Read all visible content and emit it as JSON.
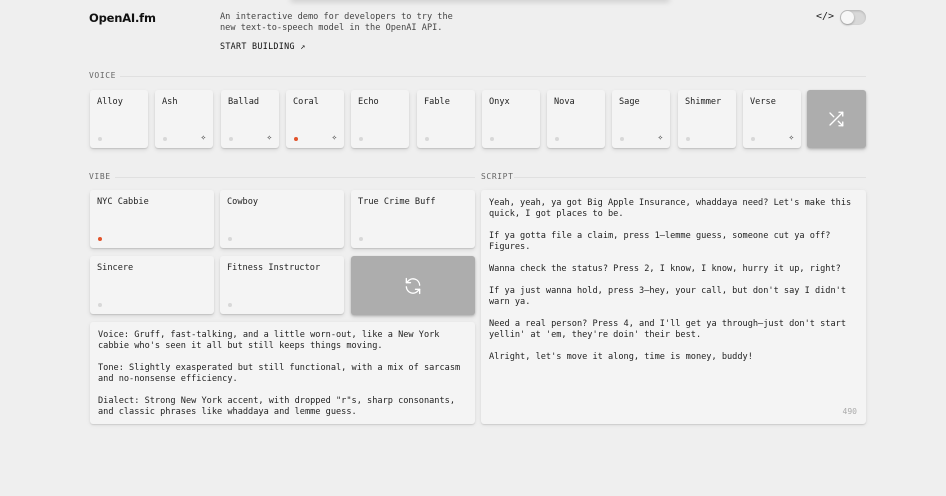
{
  "header": {
    "logo": "OpenAI.fm",
    "intro": "An interactive demo for developers to try the new text-to-speech model in the OpenAI API.",
    "start_building": "START BUILDING ↗",
    "code_icon": "</>",
    "dev_mode_toggle_on": false
  },
  "voice": {
    "section_label": "VOICE",
    "items": [
      {
        "label": "Alloy",
        "selected": false,
        "new": false
      },
      {
        "label": "Ash",
        "selected": false,
        "new": true
      },
      {
        "label": "Ballad",
        "selected": false,
        "new": true
      },
      {
        "label": "Coral",
        "selected": true,
        "new": true
      },
      {
        "label": "Echo",
        "selected": false,
        "new": false
      },
      {
        "label": "Fable",
        "selected": false,
        "new": false
      },
      {
        "label": "Onyx",
        "selected": false,
        "new": false
      },
      {
        "label": "Nova",
        "selected": false,
        "new": false
      },
      {
        "label": "Sage",
        "selected": false,
        "new": true
      },
      {
        "label": "Shimmer",
        "selected": false,
        "new": false
      },
      {
        "label": "Verse",
        "selected": false,
        "new": true
      }
    ],
    "shuffle_icon": "shuffle-icon",
    "new_icon": "sparkle-icon"
  },
  "vibe": {
    "section_label": "VIBE",
    "items": [
      {
        "label": "NYC Cabbie",
        "selected": true
      },
      {
        "label": "Cowboy",
        "selected": false
      },
      {
        "label": "True Crime Buff",
        "selected": false
      },
      {
        "label": "Sincere",
        "selected": false
      },
      {
        "label": "Fitness Instructor",
        "selected": false
      }
    ],
    "refresh_icon": "refresh-icon",
    "description": [
      "Voice: Gruff, fast-talking, and a little worn-out, like a New York cabbie who's seen it all but still keeps things moving.",
      "Tone: Slightly exasperated but still functional, with a mix of sarcasm and no-nonsense efficiency.",
      "Dialect: Strong New York accent, with dropped \"r\"s, sharp consonants, and classic phrases like whaddaya and lemme guess."
    ]
  },
  "script": {
    "section_label": "SCRIPT",
    "paragraphs": [
      "Yeah, yeah, ya got Big Apple Insurance, whaddaya need? Let's make this quick, I got places to be.",
      "If ya gotta file a claim, press 1—lemme guess, someone cut ya off? Figures.",
      "Wanna check the status? Press 2, I know, I know, hurry it up, right?",
      "If ya just wanna hold, press 3—hey, your call, but don't say I didn't warn ya.",
      "Need a real person? Press 4, and I'll get ya through—just don't start yellin' at 'em, they're doin' their best.",
      "Alright, let's move it along, time is money, buddy!"
    ],
    "char_count": "490"
  },
  "colors": {
    "accent": "#e2532b",
    "background": "#efefef",
    "card": "#f4f4f4",
    "action_button": "#adadad"
  }
}
